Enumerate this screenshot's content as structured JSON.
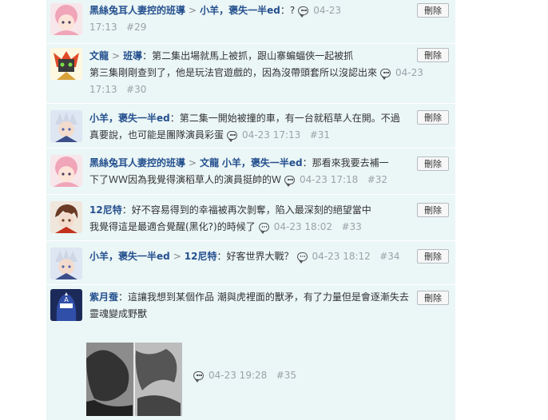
{
  "delete_label": "刪除",
  "comments": [
    {
      "names": [
        "黑絲兔耳人妻控的班導",
        "小羊，褒失一半ed"
      ],
      "text": "：?",
      "line1_meta": "04-23",
      "line2_meta": "17:13",
      "floor": "#29"
    },
    {
      "names": [
        "文龍",
        "班導"
      ],
      "text1": "：第二集出場就馬上被抓，跟山寨蝙蝠俠一起被抓",
      "text2": "第三集剛剛查到了，他是玩法官遊戲的，因為沒帶頭套所以沒認出來",
      "date": "04-23",
      "time": "17:13",
      "floor": "#30"
    },
    {
      "names": [
        "小羊，褒失一半ed"
      ],
      "text1": "：第二集一開始被撞的車，有一台就稻草人在開。不過",
      "text2": "真要說，也可能是團隊演員彩蛋",
      "datetime": "04-23 17:13",
      "floor": "#31"
    },
    {
      "names": [
        "黑絲兔耳人妻控的班導",
        "文龍",
        "小羊，褒失一半ed"
      ],
      "text1": "：那看來我要去補一",
      "text2": "下了ＷＷ因為我覺得演稻草人的演員挺帥的Ｗ",
      "datetime": "04-23 17:18",
      "floor": "#32"
    },
    {
      "names": [
        "12尼特"
      ],
      "text1": "：好不容易得到的幸福被再次剝奪，陷入最深刻的絕望當中",
      "text2": "我覺得這是最適合覺醒(黑化?)的時候了",
      "datetime": "04-23 18:02",
      "floor": "#33"
    },
    {
      "names": [
        "小羊，褒失一半ed",
        "12尼特"
      ],
      "text1": "：好客世界大戰？",
      "datetime": "04-23 18:12",
      "floor": "#34"
    },
    {
      "names": [
        "紫月蚕"
      ],
      "text1": "：這讓我想到某個作品 潮與虎裡面的獸矛，有了力量但是會逐漸失去",
      "text2": "靈魂變成野獸",
      "datetime": "04-23 19:28",
      "floor": "#35"
    }
  ]
}
